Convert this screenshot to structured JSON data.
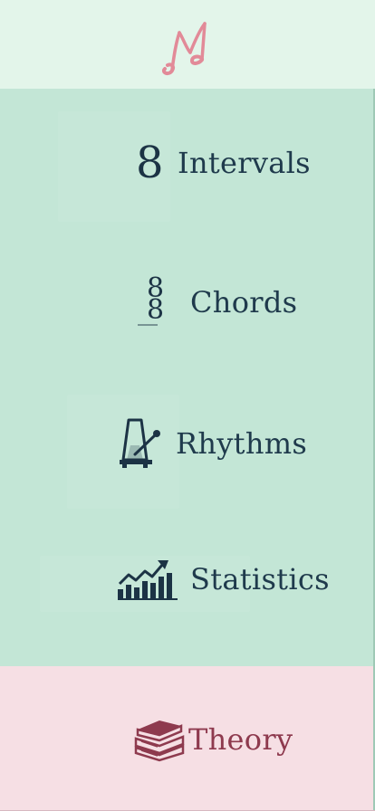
{
  "nav": {
    "items": [
      {
        "label": "Intervals",
        "icon": "interval-icon"
      },
      {
        "label": "Chords",
        "icon": "chord-icon"
      },
      {
        "label": "Rhythms",
        "icon": "metronome-icon"
      },
      {
        "label": "Statistics",
        "icon": "statistics-chart-icon"
      }
    ],
    "theory": {
      "label": "Theory",
      "icon": "books-icon"
    }
  },
  "colors": {
    "menu_bg": "#c3e6d6",
    "top_bg": "#e3f5ea",
    "theory_bg": "#f6dfe4",
    "text": "#1f3a4c",
    "theory_text": "#8e3a4e",
    "logo": "#e28a98"
  }
}
